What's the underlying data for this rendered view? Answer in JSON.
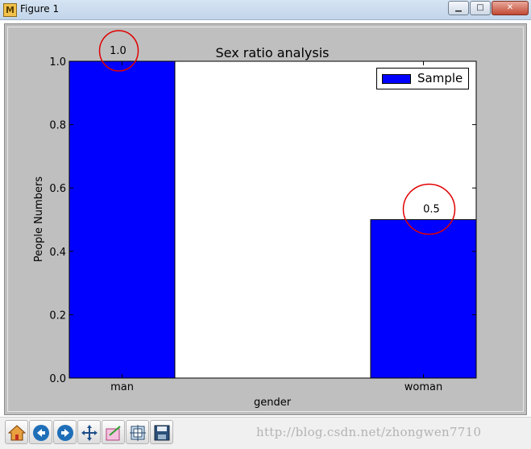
{
  "window": {
    "title": "Figure 1",
    "app_icon_glyph": "M"
  },
  "controls": {
    "minimize": "▁",
    "maximize": "□",
    "close": "✕"
  },
  "chart_data": {
    "type": "bar",
    "title": "Sex ratio analysis",
    "xlabel": "gender",
    "ylabel": "People Numbers",
    "categories": [
      "man",
      "woman"
    ],
    "series": [
      {
        "name": "Sample",
        "values": [
          1.0,
          0.5
        ],
        "color": "#0000ff"
      }
    ],
    "data_labels": [
      "1.0",
      "0.5"
    ],
    "ylim": [
      0.0,
      1.0
    ],
    "yticks": [
      "0.0",
      "0.2",
      "0.4",
      "0.6",
      "0.8",
      "1.0"
    ],
    "grid": false,
    "legend_position": "top-right",
    "annotation_circle_color": "#e00000"
  },
  "toolbar": {
    "tools": [
      "home-icon",
      "back-arrow-icon",
      "forward-arrow-icon",
      "pan-icon",
      "zoom-icon",
      "subplot-config-icon",
      "save-icon"
    ]
  },
  "watermark": "http://blog.csdn.net/zhongwen7710"
}
